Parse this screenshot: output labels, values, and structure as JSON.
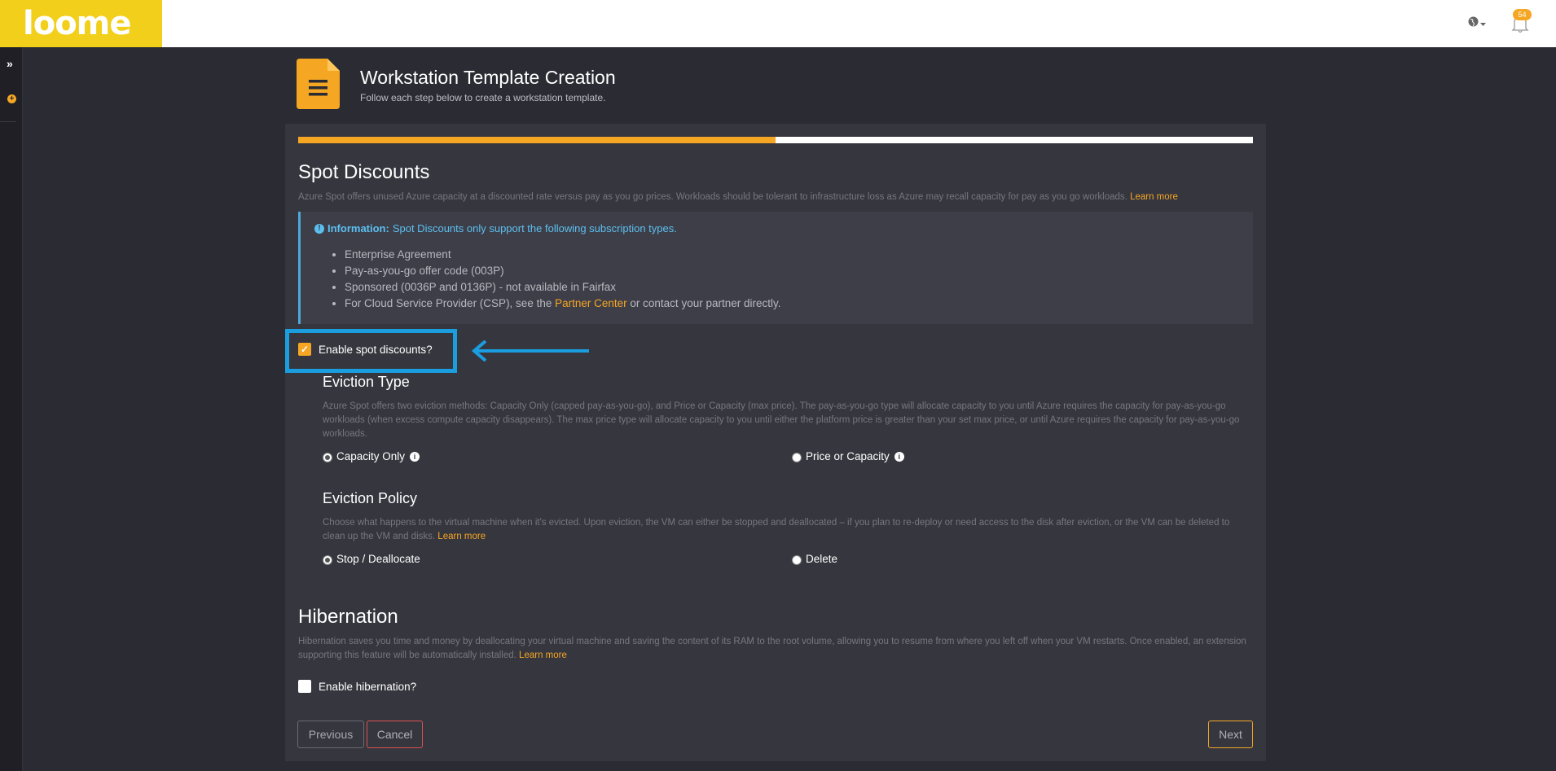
{
  "app": {
    "logo": "loome"
  },
  "topbar": {
    "notification_count": "54"
  },
  "page": {
    "title": "Workstation Template Creation",
    "subtitle": "Follow each step below to create a workstation template.",
    "progress_percent": 50
  },
  "spot": {
    "heading": "Spot Discounts",
    "description": "Azure Spot offers unused Azure capacity at a discounted rate versus pay as you go prices. Workloads should be tolerant to infrastructure loss as Azure may recall capacity for pay as you go workloads.",
    "learn_more": "Learn more",
    "info_label": "Information:",
    "info_text": "Spot Discounts only support the following subscription types.",
    "info_items": [
      "Enterprise Agreement",
      "Pay-as-you-go offer code (003P)",
      "Sponsored (0036P and 0136P) - not available in Fairfax"
    ],
    "csp_prefix": "For Cloud Service Provider (CSP), see the ",
    "csp_link": "Partner Center",
    "csp_suffix": " or contact your partner directly.",
    "enable_label": "Enable spot discounts?",
    "enabled": true
  },
  "eviction_type": {
    "heading": "Eviction Type",
    "description": "Azure Spot offers two eviction methods: Capacity Only (capped pay-as-you-go), and Price or Capacity (max price). The pay-as-you-go type will allocate capacity to you until Azure requires the capacity for pay-as-you-go workloads (when excess compute capacity disappears). The max price type will allocate capacity to you until either the platform price is greater than your set max price, or until Azure requires the capacity for pay-as-you-go workloads.",
    "option_capacity": "Capacity Only",
    "option_price": "Price or Capacity",
    "selected": "Capacity Only"
  },
  "eviction_policy": {
    "heading": "Eviction Policy",
    "description": "Choose what happens to the virtual machine when it's evicted. Upon eviction, the VM can either be stopped and deallocated – if you plan to re-deploy or need access to the disk after eviction, or the VM can be deleted to clean up the VM and disks.",
    "learn_more": "Learn more",
    "option_stop": "Stop / Deallocate",
    "option_delete": "Delete",
    "selected": "Stop / Deallocate"
  },
  "hibernation": {
    "heading": "Hibernation",
    "description": "Hibernation saves you time and money by deallocating your virtual machine and saving the content of its RAM to the root volume, allowing you to resume from where you left off when your VM restarts. Once enabled, an extension supporting this feature will be automatically installed.",
    "learn_more": "Learn more",
    "enable_label": "Enable hibernation?",
    "enabled": false
  },
  "buttons": {
    "previous": "Previous",
    "cancel": "Cancel",
    "next": "Next"
  },
  "colors": {
    "accent": "#f5a623",
    "info": "#5bc0f0",
    "highlight": "#1a9ee0",
    "danger": "#d9534f"
  },
  "icons": [
    "globe-icon",
    "bell-icon",
    "expand-icon",
    "add-icon",
    "document-icon",
    "info-icon",
    "arrow-icon"
  ]
}
